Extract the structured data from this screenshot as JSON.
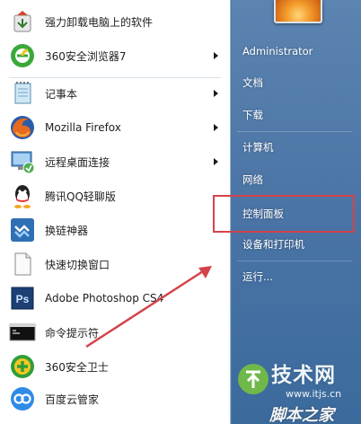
{
  "programs": [
    {
      "label": "强力卸载电脑上的软件",
      "icon": "uninstall-icon",
      "has_submenu": false
    },
    {
      "label": "360安全浏览器7",
      "icon": "browser-360-icon",
      "has_submenu": true
    },
    {
      "label": "记事本",
      "icon": "notepad-icon",
      "has_submenu": true
    },
    {
      "label": "Mozilla Firefox",
      "icon": "firefox-icon",
      "has_submenu": true
    },
    {
      "label": "远程桌面连接",
      "icon": "remote-desktop-icon",
      "has_submenu": true
    },
    {
      "label": "腾讯QQ轻聊版",
      "icon": "qq-icon",
      "has_submenu": false
    },
    {
      "label": "换链神器",
      "icon": "link-tool-icon",
      "has_submenu": false
    },
    {
      "label": "快速切换窗口",
      "icon": "window-switch-icon",
      "has_submenu": false
    },
    {
      "label": "Adobe Photoshop CS4",
      "icon": "photoshop-icon",
      "has_submenu": false
    },
    {
      "label": "命令提示符",
      "icon": "cmd-icon",
      "has_submenu": false
    },
    {
      "label": "360安全卫士",
      "icon": "safe-360-icon",
      "has_submenu": false
    },
    {
      "label": "百度云管家",
      "icon": "baidu-cloud-icon",
      "has_submenu": false
    }
  ],
  "right_menu": {
    "user": "Administrator",
    "documents": "文档",
    "downloads": "下载",
    "computer": "计算机",
    "network": "网络",
    "control_panel": "控制面板",
    "devices_printers": "设备和打印机",
    "run": "运行..."
  },
  "colors": {
    "highlight_box": "#d4434b",
    "annotation_arrow": "#d4434b",
    "right_pane": "#4a74a5"
  },
  "watermark": {
    "brand": "技术网",
    "url": "www.itjs.cn",
    "bottom": "脚本之家"
  }
}
